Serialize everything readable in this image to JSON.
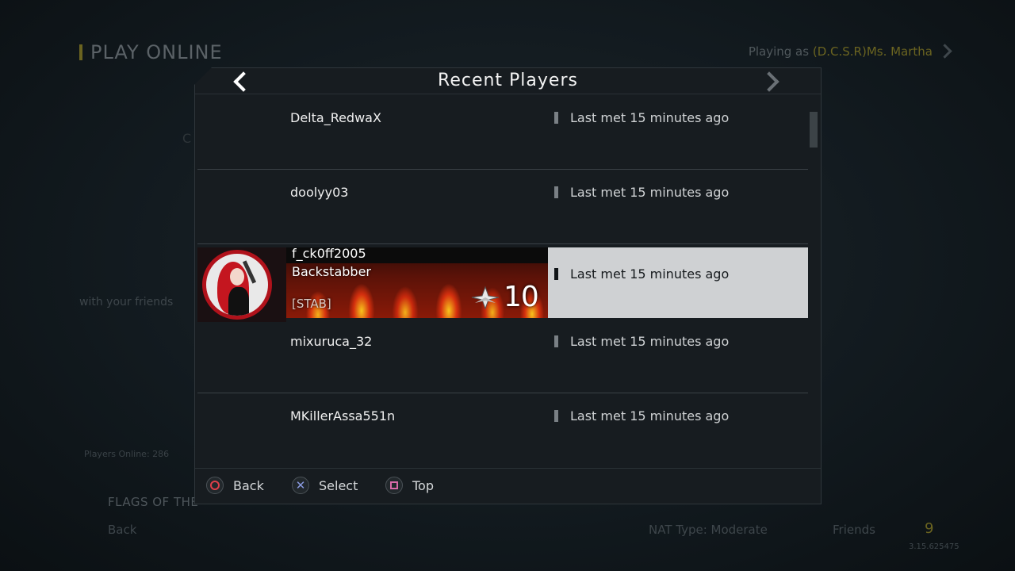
{
  "background": {
    "title": "PLAY ONLINE",
    "playing_as_prefix": "Playing as ",
    "playing_as_name": "(D.C.S.R)Ms. Martha",
    "c_fragment": "C",
    "friends_text": "with your friends",
    "players_online": "Players Online: 286",
    "flags_text": "FLAGS OF THE",
    "back_label": "Back",
    "nat_type": "NAT Type: Moderate",
    "friends_label": "Friends",
    "friends_count": "9",
    "version": "3.15.625475"
  },
  "modal": {
    "title": "Recent Players",
    "players": [
      {
        "name": "Delta_RedwaX",
        "last_met": "Last met 15 minutes ago"
      },
      {
        "name": "doolyy03",
        "last_met": "Last met 15 minutes ago"
      },
      {
        "name": "f_ck0ff2005",
        "title": "Backstabber",
        "clan": "[STAB]",
        "rank": "10",
        "last_met": "Last met 15 minutes ago",
        "selected": true
      },
      {
        "name": "mixuruca_32",
        "last_met": "Last met 15 minutes ago"
      },
      {
        "name": "MKillerAssa551n",
        "last_met": "Last met 15 minutes ago"
      }
    ]
  },
  "footer": {
    "back": "Back",
    "select": "Select",
    "top": "Top"
  },
  "colors": {
    "accent_gold": "#6b6420",
    "selected_row": "#cfd1d3",
    "emblem_red": "#b0121b"
  }
}
